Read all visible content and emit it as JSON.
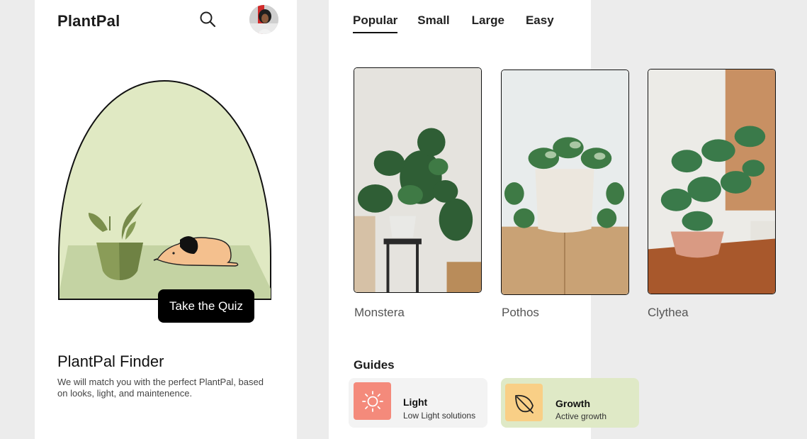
{
  "app": {
    "title": "PlantPal"
  },
  "hero": {
    "cta_label": "Take the Quiz"
  },
  "finder": {
    "title": "PlantPal Finder",
    "description": "We will match you with the perfect PlantPal, based on looks, light, and maintenence."
  },
  "tabs": [
    {
      "label": "Popular",
      "active": true
    },
    {
      "label": "Small",
      "active": false
    },
    {
      "label": "Large",
      "active": false
    },
    {
      "label": "Easy",
      "active": false
    }
  ],
  "plants": [
    {
      "name": "Monstera"
    },
    {
      "name": "Pothos"
    },
    {
      "name": "Clythea"
    }
  ],
  "guides": {
    "title": "Guides",
    "items": [
      {
        "title": "Light",
        "subtitle": "Low Light solutions",
        "icon": "sun-icon",
        "icon_bg": "#f48a7b",
        "card_bg": "#f3f3f3"
      },
      {
        "title": "Growth",
        "subtitle": "Active growth",
        "icon": "leaf-icon",
        "icon_bg": "#f9cf86",
        "card_bg": "#dfe9c6"
      }
    ]
  },
  "colors": {
    "accent": "#000000",
    "hero_green": "#e0e9c3"
  }
}
